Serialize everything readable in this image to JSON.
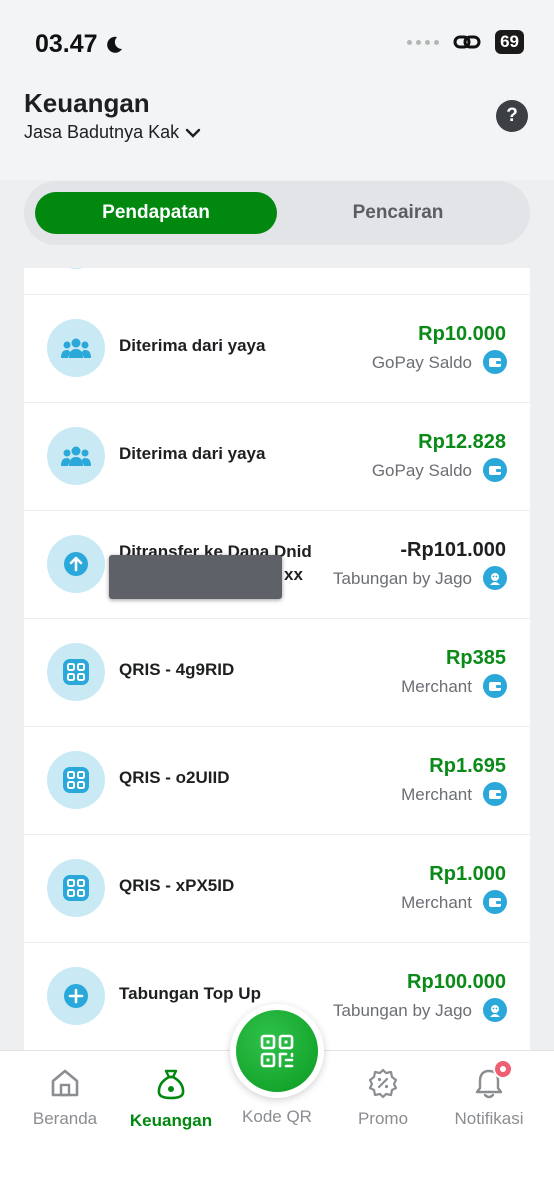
{
  "status_bar": {
    "time": "03.47",
    "battery": "69"
  },
  "header": {
    "title": "Keuangan",
    "account": "Jasa Badutnya Kak",
    "help": "?"
  },
  "tabs": [
    {
      "label": "Pendapatan",
      "active": true
    },
    {
      "label": "Pencairan",
      "active": false
    }
  ],
  "transactions": [
    {
      "title": "Diterima dari yaya",
      "amount": "Rp10.000",
      "source": "GoPay Saldo",
      "icon": "people-icon",
      "source_icon": "wallet-icon",
      "type": "credit"
    },
    {
      "title": "Diterima dari yaya",
      "amount": "Rp12.828",
      "source": "GoPay Saldo",
      "icon": "people-icon",
      "source_icon": "wallet-icon",
      "type": "credit"
    },
    {
      "title": "Ditransfer ke Dana Dnid",
      "title_tail": "xx",
      "amount": "-Rp101.000",
      "source": "Tabungan by Jago",
      "icon": "arrow-up-icon",
      "source_icon": "jago-icon",
      "type": "debit"
    },
    {
      "title": "QRIS - 4g9RID",
      "amount": "Rp385",
      "source": "Merchant",
      "icon": "qris-icon",
      "source_icon": "wallet-icon",
      "type": "credit"
    },
    {
      "title": "QRIS - o2UIID",
      "amount": "Rp1.695",
      "source": "Merchant",
      "icon": "qris-icon",
      "source_icon": "wallet-icon",
      "type": "credit"
    },
    {
      "title": "QRIS - xPX5ID",
      "amount": "Rp1.000",
      "source": "Merchant",
      "icon": "qris-icon",
      "source_icon": "wallet-icon",
      "type": "credit"
    },
    {
      "title": "Tabungan Top Up",
      "amount": "Rp100.000",
      "source": "Tabungan by Jago",
      "icon": "plus-icon",
      "source_icon": "jago-icon",
      "type": "credit"
    }
  ],
  "bottom_nav": [
    {
      "label": "Beranda",
      "icon": "home-icon",
      "active": false
    },
    {
      "label": "Keuangan",
      "icon": "money-bag-icon",
      "active": true
    },
    {
      "label": "Kode QR",
      "icon": "qr-code-icon",
      "active": false
    },
    {
      "label": "Promo",
      "icon": "percent-badge-icon",
      "active": false
    },
    {
      "label": "Notifikasi",
      "icon": "bell-icon",
      "active": false
    }
  ],
  "colors": {
    "green": "#00880f",
    "credit": "#0a8a17",
    "debit": "#1d1f21",
    "icon_bg": "#c9e9f5",
    "icon_fg": "#29a8d9"
  }
}
